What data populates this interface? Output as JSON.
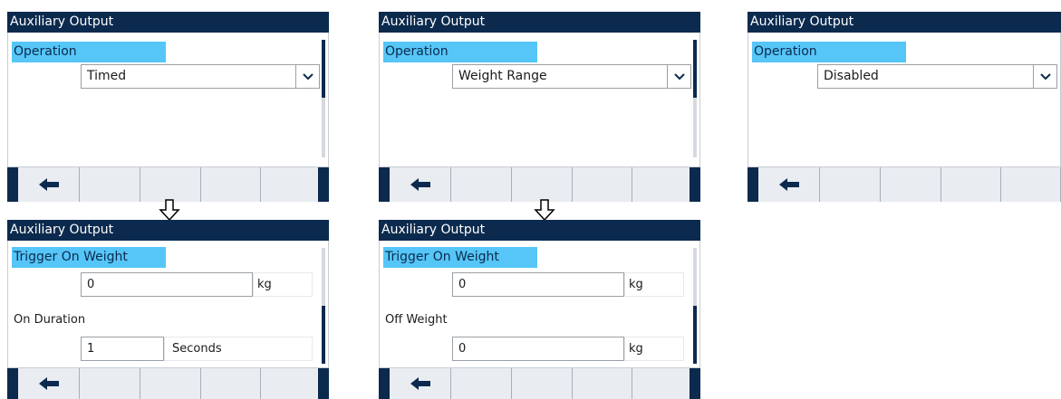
{
  "screens": [
    {
      "title": "Auxiliary Output",
      "operation_label": "Operation",
      "operation_value": "Timed"
    },
    {
      "title": "Auxiliary Output",
      "operation_label": "Operation",
      "operation_value": "Weight Range"
    },
    {
      "title": "Auxiliary Output",
      "operation_label": "Operation",
      "operation_value": "Disabled"
    },
    {
      "title": "Auxiliary Output",
      "trigger_label": "Trigger On Weight",
      "trigger_value": "0",
      "trigger_unit": "kg",
      "second_label": "On Duration",
      "second_value": "1",
      "second_unit": "Seconds"
    },
    {
      "title": "Auxiliary Output",
      "trigger_label": "Trigger On Weight",
      "trigger_value": "0",
      "trigger_unit": "kg",
      "second_label": "Off Weight",
      "second_value": "0",
      "second_unit": "kg"
    }
  ],
  "icons": {
    "back": "left-arrow-icon",
    "dropdown": "chevron-down-icon",
    "flow": "down-arrow-icon"
  },
  "colors": {
    "titlebar": "#0c2a4e",
    "highlight": "#55c6f7",
    "softkey_bg": "#e9ecf0"
  }
}
